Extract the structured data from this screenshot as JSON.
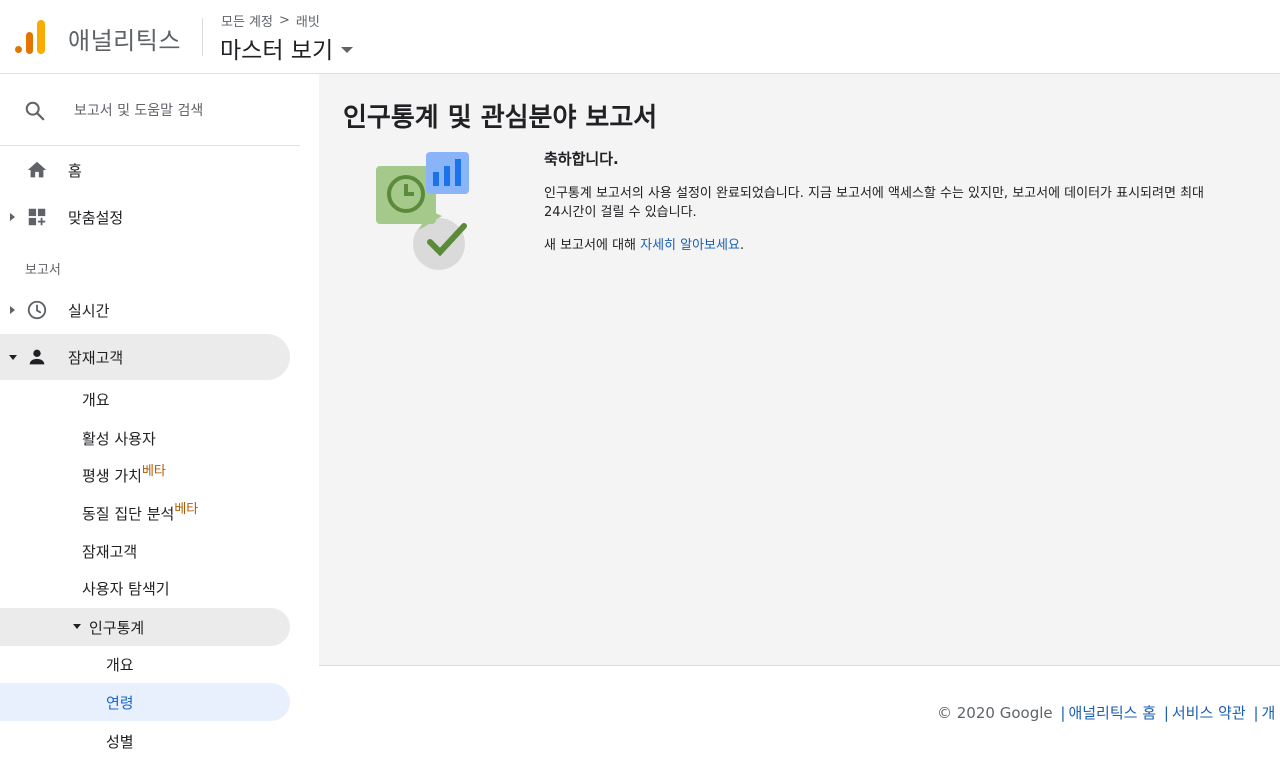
{
  "header": {
    "app_name": "애널리틱스",
    "breadcrumb_all_accounts": "모든 계정",
    "breadcrumb_separator": ">",
    "breadcrumb_property": "래빗",
    "view_name": "마스터 보기"
  },
  "sidebar": {
    "search_placeholder": "보고서 및 도움말 검색",
    "home": "홈",
    "customization": "맞춤설정",
    "reports_section": "보고서",
    "realtime": "실시간",
    "audience": "잠재고객",
    "audience_items": {
      "overview": "개요",
      "active_users": "활성 사용자",
      "lifetime_value": "평생 가치",
      "cohort": "동질 집단 분석",
      "beta": "베타",
      "audiences": "잠재고객",
      "user_explorer": "사용자 탐색기",
      "demographics": "인구통계",
      "demo_overview": "개요",
      "age": "연령",
      "gender": "성별"
    }
  },
  "main": {
    "title": "인구통계 및 관심분야 보고서",
    "congrats": "축하합니다.",
    "body": "인구통계 보고서의 사용 설정이 완료되었습니다. 지금 보고서에 액세스할 수는 있지만, 보고서에 데이터가 표시되려면 최대 24시간이 걸릴 수 있습니다.",
    "more_prefix": "새 보고서에 대해 ",
    "more_link": "자세히 알아보세요",
    "more_suffix": "."
  },
  "footer": {
    "copyright": "© 2020 Google",
    "sep": "|",
    "link_home": "애널리틱스 홈",
    "link_terms": "서비스 약관",
    "link_more": "개"
  },
  "colors": {
    "accent_blue": "#1a73e8",
    "logo_orange": "#e37400",
    "logo_yellow": "#f9ab00",
    "beta_orange": "#b35900",
    "check_green": "#5a8a3a"
  }
}
